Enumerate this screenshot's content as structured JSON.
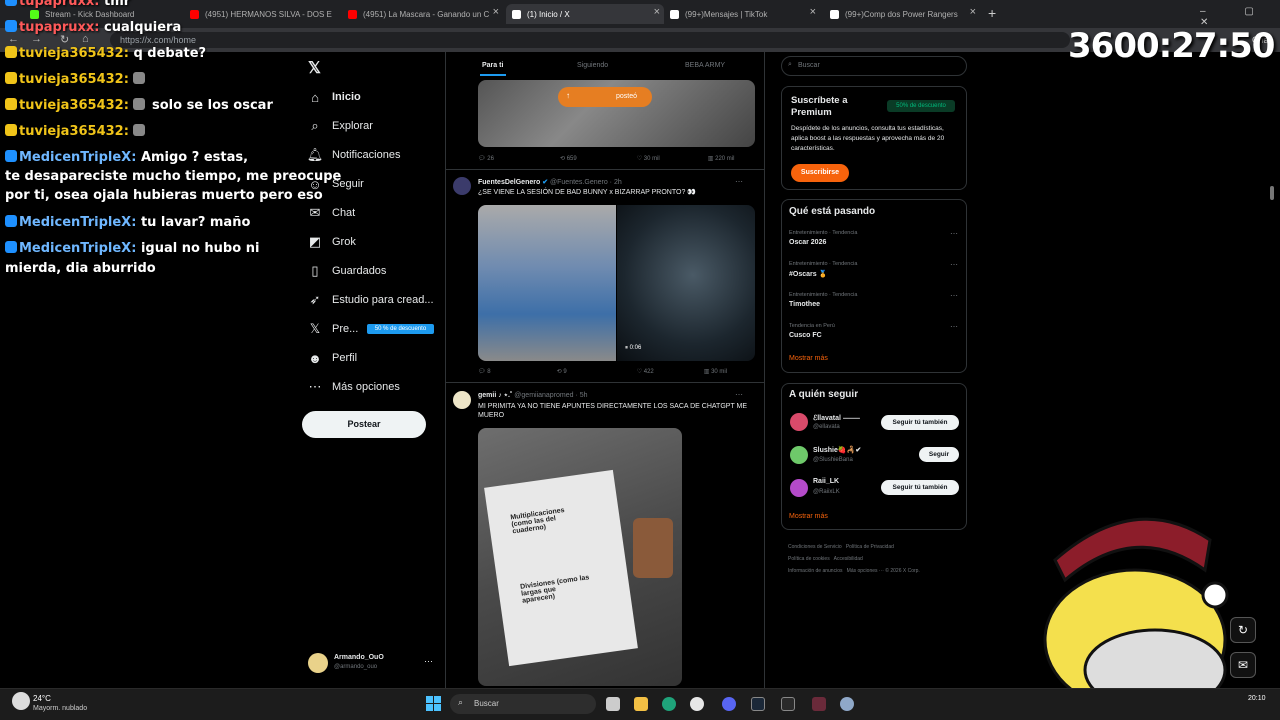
{
  "browser": {
    "tabs": [
      {
        "label": "Stream - Kick Dashboard",
        "color": "#53fc18"
      },
      {
        "label": "(4951) HERMANOS SILVA - DOS E",
        "color": "#ff0000"
      },
      {
        "label": "(4951) La Mascara - Ganando un C",
        "color": "#ff0000"
      },
      {
        "label": "(1) Inicio / X",
        "color": "#ffffff"
      },
      {
        "label": "(99+)Mensajes | TikTok",
        "color": "#ffffff"
      },
      {
        "label": "(99+)Comp dos Power Rangers",
        "color": "#ffffff"
      }
    ],
    "url": "https://x.com/home",
    "chat_label": "Chat"
  },
  "timer": "3600:27:50",
  "chat": {
    "messages": [
      {
        "user": "tupapruxx:",
        "text": "tmr",
        "cls": "user-r"
      },
      {
        "user": "tupapruxx:",
        "text": "cualquiera",
        "cls": "user-r"
      },
      {
        "user": "tuvieja365432:",
        "text": "q debate?",
        "cls": "user-t"
      },
      {
        "user": "tuvieja365432:",
        "text": "",
        "cls": "user-t"
      },
      {
        "user": "tuvieja365432:",
        "text": "solo se los oscar",
        "cls": "user-t"
      },
      {
        "user": "tuvieja365432:",
        "text": "",
        "cls": "user-t"
      },
      {
        "user": "MedicenTripleX:",
        "text": "Amigo      ?        estas,",
        "cls": "user-m"
      },
      {
        "user": "",
        "text": "te desapareciste mucho tiempo, me preocupe",
        "cls": ""
      },
      {
        "user": "",
        "text": "por ti, osea ojala hubieras muerto pero eso",
        "cls": ""
      },
      {
        "user": "MedicenTripleX:",
        "text": "tu lavar? maño",
        "cls": "user-m"
      },
      {
        "user": "MedicenTripleX:",
        "text": "igual no hubo ni",
        "cls": "user-m"
      },
      {
        "user": "",
        "text": "mierda, dia aburrido",
        "cls": ""
      }
    ]
  },
  "nav": {
    "items": [
      "Inicio",
      "Explorar",
      "Notificaciones",
      "Seguir",
      "Chat",
      "Grok",
      "Guardados",
      "Estudio para cread...",
      "Pre...",
      "Perfil",
      "Más opciones"
    ],
    "premium_badge": "50 % de descuento",
    "post_button": "Postear",
    "account_name": "Armando_OuO",
    "account_handle": "@armando_ouo"
  },
  "feed": {
    "tabs": [
      "Para ti",
      "Siguiendo",
      "BEBA ARMY"
    ],
    "posted_pill": "posteó",
    "post1_actions": [
      "26",
      "659",
      "30 mil",
      "220 mil"
    ],
    "post2": {
      "author": "FuentesDelGenero",
      "handle": "@Fuentes.Genero · 2h",
      "text": "¿SE VIENE LA SESIÓN DE BAD BUNNY x BIZARRAP PRONTO? 👀",
      "video_time": "0:06",
      "actions": [
        "8",
        "9",
        "422",
        "30 mil"
      ]
    },
    "post3": {
      "author": "gemii ♪ ⋆.˚",
      "handle": "@gemiianapromed · 5h",
      "text": "MI PRIMITA YA NO TIENE APUNTES DIRECTAMENTE LOS SACA DE CHATGPT ME MUERO"
    },
    "paper_lines": [
      "Multiplicaciones (como las del cuaderno)",
      "Divisiones (como las largas que aparecen)"
    ]
  },
  "sidebar": {
    "search_placeholder": "Buscar",
    "premium": {
      "title": "Suscríbete a Premium",
      "badge": "50% de descuento",
      "desc": "Despídete de los anuncios, consulta tus estadísticas, aplica boost a las respuestas y aprovecha más de 20 características.",
      "button": "Suscribirse"
    },
    "trends_title": "Qué está pasando",
    "trends": [
      {
        "sub": "Entretenimiento · Tendencia",
        "main": "Oscar 2026"
      },
      {
        "sub": "Entretenimiento · Tendencia",
        "main": "#Oscars 🏅"
      },
      {
        "sub": "Entretenimiento · Tendencia",
        "main": "Timothee"
      },
      {
        "sub": "Tendencia en Perú",
        "main": "Cusco FC"
      }
    ],
    "show_more": "Mostrar más",
    "follow_title": "A quién seguir",
    "follow": [
      {
        "name": "ℰllavatal ⸻",
        "handle": "@ellavata",
        "button": "Seguir tú también",
        "color": "#d94a6a"
      },
      {
        "name": "Slushie🍓🦂✔",
        "handle": "@SlushieBana",
        "button": "Seguir",
        "color": "#6ec96a"
      },
      {
        "name": "Raii_LK",
        "handle": "@RaiixLK",
        "button": "Seguir tú también",
        "color": "#b44ac9"
      }
    ],
    "follow_more": "Mostrar más",
    "footer": [
      "Condiciones de Servicio",
      "Política de Privacidad",
      "Política de cookies",
      "Accesibilidad",
      "Información de anuncios",
      "Más opciones ··· © 2026 X Corp."
    ]
  },
  "taskbar": {
    "weather_temp": "24°C",
    "weather_desc": "Mayorm. nublado",
    "search": "Buscar",
    "time": "20:10"
  }
}
